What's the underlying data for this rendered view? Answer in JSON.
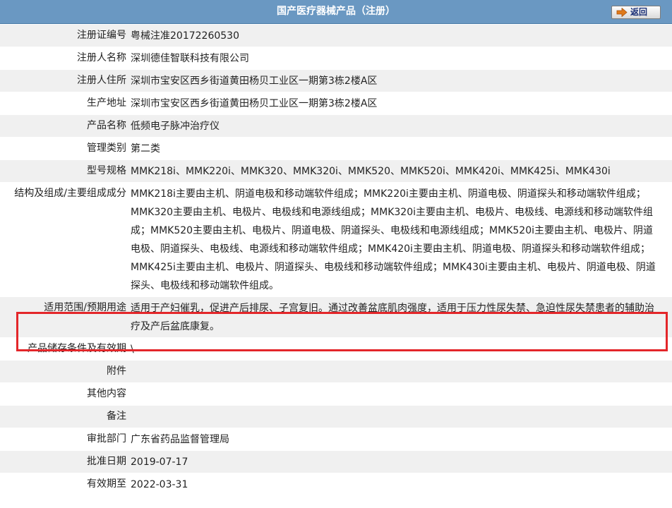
{
  "header": {
    "title": "国产医疗器械产品（注册）",
    "back_label": "返回"
  },
  "fields": [
    {
      "label": "注册证编号",
      "value": "粤械注准20172260530"
    },
    {
      "label": "注册人名称",
      "value": "深圳德佳智联科技有限公司"
    },
    {
      "label": "注册人住所",
      "value": "深圳市宝安区西乡街道黄田杨贝工业区一期第3栋2楼A区"
    },
    {
      "label": "生产地址",
      "value": "深圳市宝安区西乡街道黄田杨贝工业区一期第3栋2楼A区"
    },
    {
      "label": "产品名称",
      "value": "低频电子脉冲治疗仪"
    },
    {
      "label": "管理类别",
      "value": "第二类"
    },
    {
      "label": "型号规格",
      "value": "MMK218i、MMK220i、MMK320、MMK320i、MMK520、MMK520i、MMK420i、MMK425i、MMK430i"
    },
    {
      "label": "结构及组成/主要组成成分",
      "value": "MMK218i主要由主机、阴道电极和移动端软件组成；MMK220i主要由主机、阴道电极、阴道探头和移动端软件组成；MMK320主要由主机、电极片、电极线和电源线组成；MMK320i主要由主机、电极片、电极线、电源线和移动端软件组成；MMK520主要由主机、电极片、阴道电极、阴道探头、电极线和电源线组成；MMK520i主要由主机、电极片、阴道电极、阴道探头、电极线、电源线和移动端软件组成；MMK420i主要由主机、阴道电极、阴道探头和移动端软件组成；MMK425i主要由主机、电极片、阴道探头、电极线和移动端软件组成；MMK430i主要由主机、电极片、阴道电极、阴道探头、电极线和移动端软件组成。"
    },
    {
      "label": "适用范围/预期用途",
      "value": "适用于产妇催乳，促进产后排尿、子宫复旧。通过改善盆底肌肉强度，适用于压力性尿失禁、急迫性尿失禁患者的辅助治疗及产后盆底康复。"
    },
    {
      "label": "产品储存条件及有效期",
      "value": "\\"
    },
    {
      "label": "附件",
      "value": ""
    },
    {
      "label": "其他内容",
      "value": ""
    },
    {
      "label": "备注",
      "value": ""
    },
    {
      "label": "审批部门",
      "value": "广东省药品监督管理局"
    },
    {
      "label": "批准日期",
      "value": "2019-07-17"
    },
    {
      "label": "有效期至",
      "value": "2022-03-31"
    }
  ],
  "colors": {
    "header_bg": "#6a98c2",
    "highlight": "#e3262a"
  }
}
